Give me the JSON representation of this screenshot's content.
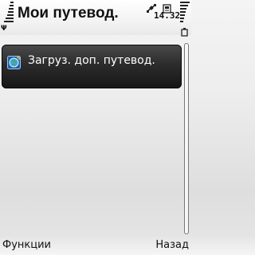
{
  "header": {
    "title": "Мои путевод.",
    "clock": "14.32",
    "signal_label": "Ψ"
  },
  "list": {
    "items": [
      {
        "label": "Загруз. доп. путевод.",
        "icon": "globe-download-icon"
      }
    ]
  },
  "softkeys": {
    "left": "Функции",
    "right": "Назад"
  },
  "icons": {
    "status": [
      "gps-satellite-icon",
      "memory-card-icon",
      "battery-icon",
      "signal-strength-icon"
    ]
  },
  "colors": {
    "selection_bg": "#222222",
    "selection_text": "#ffffff",
    "text": "#111111"
  }
}
